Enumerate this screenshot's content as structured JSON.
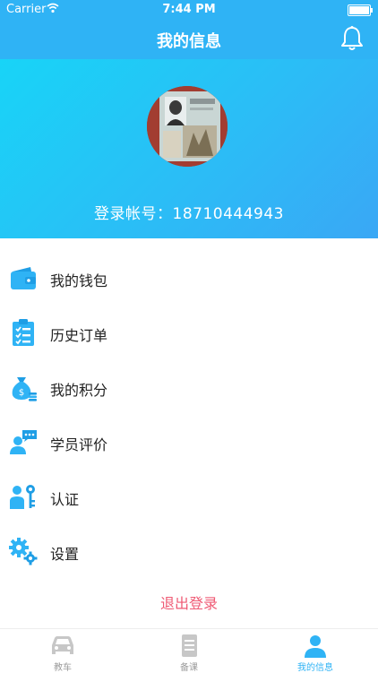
{
  "status_bar": {
    "carrier": "Carrier",
    "time": "7:44 PM"
  },
  "nav": {
    "title": "我的信息",
    "bell_icon": "bell-icon"
  },
  "profile": {
    "account_label": "登录帐号：18710444943"
  },
  "menu": [
    {
      "label": "我的钱包",
      "icon": "wallet-icon"
    },
    {
      "label": "历史订单",
      "icon": "order-list-icon"
    },
    {
      "label": "我的积分",
      "icon": "points-bag-icon"
    },
    {
      "label": "学员评价",
      "icon": "review-icon"
    },
    {
      "label": "认证",
      "icon": "certification-icon"
    },
    {
      "label": "设置",
      "icon": "settings-gears-icon"
    }
  ],
  "logout": {
    "label": "退出登录"
  },
  "tabs": [
    {
      "label": "教车",
      "icon": "car-icon",
      "active": false
    },
    {
      "label": "备课",
      "icon": "document-icon",
      "active": false
    },
    {
      "label": "我的信息",
      "icon": "user-icon",
      "active": true
    }
  ],
  "colors": {
    "primary": "#2fb3f5",
    "logout": "#ef5a74",
    "inactive": "#9b9b9b"
  }
}
